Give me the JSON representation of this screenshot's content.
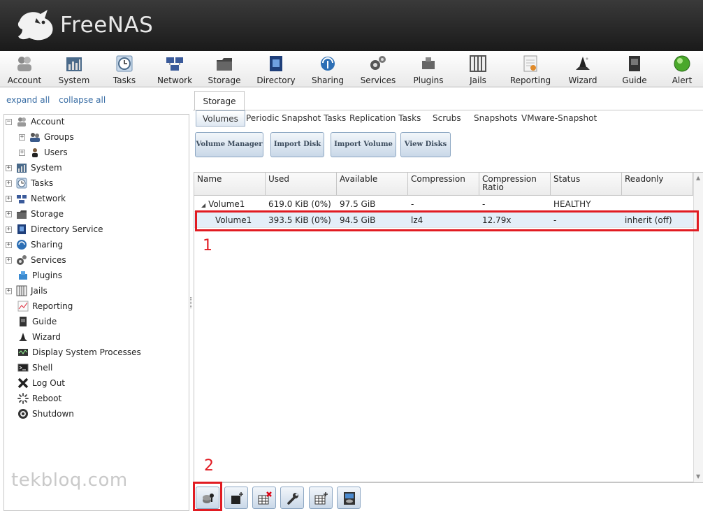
{
  "app": {
    "logo_text": "FreeNAS",
    "trademark": "™"
  },
  "toolbar": {
    "items": [
      {
        "label": "Account",
        "icon": "account-icon"
      },
      {
        "label": "System",
        "icon": "system-icon"
      },
      {
        "label": "Tasks",
        "icon": "tasks-icon"
      },
      {
        "label": "Network",
        "icon": "network-icon"
      },
      {
        "label": "Storage",
        "icon": "storage-icon"
      },
      {
        "label": "Directory",
        "icon": "directory-icon"
      },
      {
        "label": "Sharing",
        "icon": "sharing-icon"
      },
      {
        "label": "Services",
        "icon": "services-icon"
      },
      {
        "label": "Plugins",
        "icon": "plugins-icon"
      },
      {
        "label": "Jails",
        "icon": "jails-icon"
      },
      {
        "label": "Reporting",
        "icon": "reporting-icon"
      },
      {
        "label": "Wizard",
        "icon": "wizard-icon"
      },
      {
        "label": "Guide",
        "icon": "guide-icon"
      },
      {
        "label": "Alert",
        "icon": "alert-icon"
      }
    ]
  },
  "sidebar": {
    "expand_all": "expand all",
    "collapse_all": "collapse all",
    "tree": [
      {
        "label": "Account",
        "expander": "−",
        "icon": "account-icon"
      },
      {
        "label": "Groups",
        "expander": "+",
        "icon": "groups-icon"
      },
      {
        "label": "Users",
        "expander": "+",
        "icon": "users-icon"
      },
      {
        "label": "System",
        "expander": "+",
        "icon": "system-icon"
      },
      {
        "label": "Tasks",
        "expander": "+",
        "icon": "tasks-icon"
      },
      {
        "label": "Network",
        "expander": "+",
        "icon": "network-icon"
      },
      {
        "label": "Storage",
        "expander": "+",
        "icon": "storage-icon"
      },
      {
        "label": "Directory Service",
        "expander": "+",
        "icon": "directory-icon"
      },
      {
        "label": "Sharing",
        "expander": "+",
        "icon": "sharing-icon"
      },
      {
        "label": "Services",
        "expander": "+",
        "icon": "services-icon"
      },
      {
        "label": "Plugins",
        "expander": "",
        "icon": "plugins-icon"
      },
      {
        "label": "Jails",
        "expander": "+",
        "icon": "jails-icon"
      },
      {
        "label": "Reporting",
        "expander": "",
        "icon": "reporting-icon"
      },
      {
        "label": "Guide",
        "expander": "",
        "icon": "guide-icon"
      },
      {
        "label": "Wizard",
        "expander": "",
        "icon": "wizard-icon"
      },
      {
        "label": "Display System Processes",
        "expander": "",
        "icon": "processes-icon"
      },
      {
        "label": "Shell",
        "expander": "",
        "icon": "shell-icon"
      },
      {
        "label": "Log Out",
        "expander": "",
        "icon": "logout-icon"
      },
      {
        "label": "Reboot",
        "expander": "",
        "icon": "reboot-icon"
      },
      {
        "label": "Shutdown",
        "expander": "",
        "icon": "shutdown-icon"
      }
    ]
  },
  "main": {
    "tab": "Storage",
    "subtabs": [
      "Volumes",
      "Periodic Snapshot Tasks",
      "Replication Tasks",
      "Scrubs",
      "Snapshots",
      "VMware-Snapshot"
    ],
    "buttons": [
      "Volume Manager",
      "Import Disk",
      "Import Volume",
      "View Disks"
    ],
    "grid": {
      "headers": [
        "Name",
        "Used",
        "Available",
        "Compression",
        "Compression Ratio",
        "Status",
        "Readonly"
      ],
      "rows": [
        {
          "name": "Volume1",
          "used": "619.0 KiB (0%)",
          "available": "97.5 GiB",
          "compression": "-",
          "ratio": "-",
          "status": "HEALTHY",
          "readonly": ""
        },
        {
          "name": "Volume1",
          "used": "393.5 KiB (0%)",
          "available": "94.5 GiB",
          "compression": "lz4",
          "ratio": "12.79x",
          "status": "-",
          "readonly": "inherit (off)"
        }
      ]
    },
    "annotations": [
      "1",
      "2"
    ],
    "bottom_buttons": [
      "change-passphrase-icon",
      "add-dataset-icon",
      "delete-icon",
      "settings-icon",
      "add-zvol-icon",
      "volume-status-icon"
    ]
  },
  "watermark": "tekbloq.com",
  "colors": {
    "accent": "#3a6ea5",
    "highlight": "#e11b22",
    "selected_row": "#e4eef8"
  }
}
